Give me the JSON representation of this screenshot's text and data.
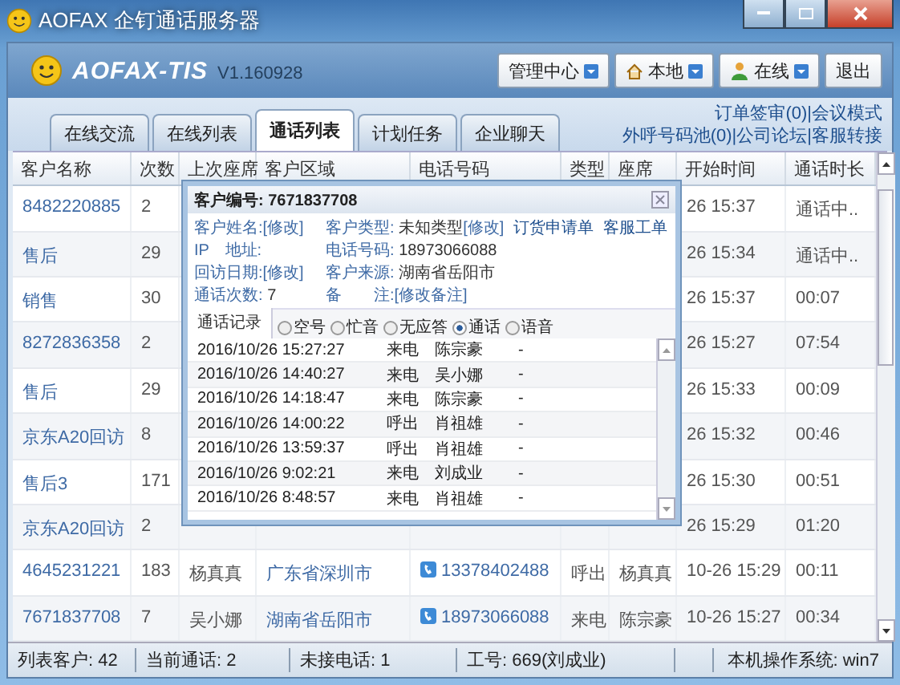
{
  "window": {
    "title": "AOFAX 企钉通话服务器"
  },
  "header": {
    "logo": "AOFAX-TIS",
    "version": "V1.160928",
    "buttons": [
      {
        "label": "管理中心",
        "kind": "plain",
        "dropdown": true
      },
      {
        "label": "本地",
        "kind": "home",
        "dropdown": true
      },
      {
        "label": "在线",
        "kind": "user",
        "dropdown": true
      },
      {
        "label": "退出",
        "kind": "plain",
        "dropdown": false
      }
    ]
  },
  "tabs": [
    {
      "label": "在线交流",
      "selected": false
    },
    {
      "label": "在线列表",
      "selected": false
    },
    {
      "label": "通话列表",
      "selected": true
    },
    {
      "label": "计划任务",
      "selected": false
    },
    {
      "label": "企业聊天",
      "selected": false
    }
  ],
  "links": [
    "订单签审(0)|会议模式",
    "外呼号码池(0)|公司论坛|客服转接"
  ],
  "table": {
    "columns": [
      "客户名称",
      "次数",
      "上次座席",
      "客户区域",
      "电话号码",
      "类型",
      "座席",
      "开始时间",
      "通话时长"
    ],
    "rows": [
      {
        "name": "8482220885",
        "count": "2",
        "start": "26 15:37",
        "duration": "通话中.."
      },
      {
        "name": "售后",
        "count": "29",
        "start": "26 15:34",
        "duration": "通话中.."
      },
      {
        "name": "销售",
        "count": "30",
        "start": "26 15:37",
        "duration": "00:07"
      },
      {
        "name": "8272836358",
        "count": "2",
        "start": "26 15:27",
        "duration": "07:54"
      },
      {
        "name": "售后",
        "count": "29",
        "start": "26 15:33",
        "duration": "00:09"
      },
      {
        "name": "京东A20回访",
        "count": "8",
        "start": "26 15:32",
        "duration": "00:46"
      },
      {
        "name": "售后3",
        "count": "171",
        "start": "26 15:30",
        "duration": "00:51"
      },
      {
        "name": "京东A20回访",
        "count": "2",
        "start": "26 15:29",
        "duration": "01:20"
      },
      {
        "name": "4645231221",
        "count": "183",
        "last_agent": "杨真真",
        "region": "广东省深圳市",
        "phone": "13378402488",
        "type": "呼出",
        "agent": "杨真真",
        "start": "10-26 15:29",
        "duration": "00:11"
      },
      {
        "name": "7671837708",
        "count": "7",
        "last_agent": "吴小娜",
        "region": "湖南省岳阳市",
        "phone": "18973066088",
        "type": "来电",
        "agent": "陈宗豪",
        "start": "10-26 15:27",
        "duration": "00:34"
      }
    ]
  },
  "dialog": {
    "title": "客户编号: 7671837708",
    "left": [
      {
        "label": "客户姓名:",
        "link": "[修改]"
      },
      {
        "label": "IP　地址:"
      },
      {
        "label": "回访日期:",
        "link": "[修改]"
      },
      {
        "label": "通话次数:",
        "value": "7"
      }
    ],
    "right": [
      {
        "label": "客户类型:",
        "value": "未知类型",
        "link": "[修改]"
      },
      {
        "label": "电话号码:",
        "value": "18973066088"
      },
      {
        "label": "客户来源:",
        "value": "湖南省岳阳市"
      },
      {
        "label": "备　　注:",
        "link": "[修改备注]"
      }
    ],
    "actions": [
      "订货申请单",
      "客服工单"
    ],
    "tab": "通话记录",
    "filters": [
      {
        "label": "空号",
        "selected": false
      },
      {
        "label": "忙音",
        "selected": false
      },
      {
        "label": "无应答",
        "selected": false
      },
      {
        "label": "通话",
        "selected": true
      },
      {
        "label": "语音",
        "selected": false
      }
    ],
    "records": [
      {
        "time": "2016/10/26 15:27:27",
        "type": "来电",
        "agent": "陈宗豪",
        "note": "-"
      },
      {
        "time": "2016/10/26 14:40:27",
        "type": "来电",
        "agent": "吴小娜",
        "note": "-"
      },
      {
        "time": "2016/10/26 14:18:47",
        "type": "来电",
        "agent": "陈宗豪",
        "note": "-"
      },
      {
        "time": "2016/10/26 14:00:22",
        "type": "呼出",
        "agent": "肖祖雄",
        "note": "-"
      },
      {
        "time": "2016/10/26 13:59:37",
        "type": "呼出",
        "agent": "肖祖雄",
        "note": "-"
      },
      {
        "time": "2016/10/26 9:02:21",
        "type": "来电",
        "agent": "刘成业",
        "note": "-"
      },
      {
        "time": "2016/10/26 8:48:57",
        "type": "来电",
        "agent": "肖祖雄",
        "note": "-"
      }
    ]
  },
  "status_bar": [
    "列表客户: 42",
    "当前通话: 2",
    "未接电话: 1",
    "工号: 669(刘成业)",
    "本机操作系统: win7"
  ]
}
